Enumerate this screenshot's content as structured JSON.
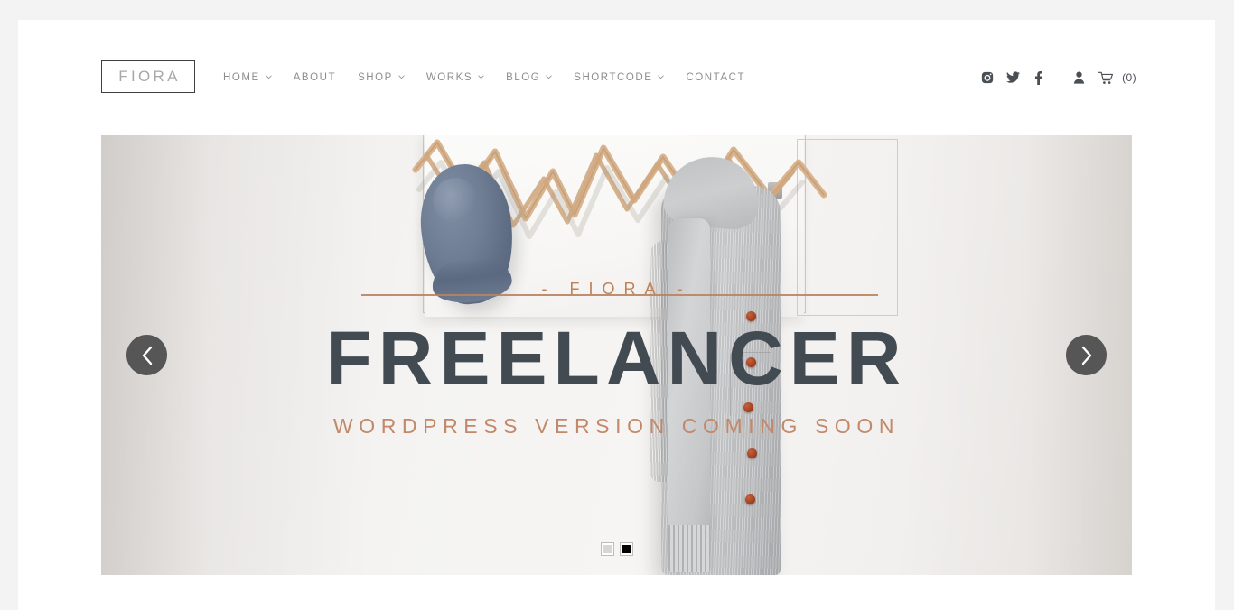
{
  "site": {
    "background_color": "#f3f3f3",
    "container_color": "#ffffff"
  },
  "header": {
    "logo": {
      "text": "FIORA",
      "border_color": "#3f3f3f",
      "text_color": "#a9a7aa"
    },
    "nav_items": [
      {
        "label": "HOME",
        "has_dropdown": true
      },
      {
        "label": "ABOUT",
        "has_dropdown": false
      },
      {
        "label": "SHOP",
        "has_dropdown": true
      },
      {
        "label": "WORKS",
        "has_dropdown": true
      },
      {
        "label": "BLOG",
        "has_dropdown": true
      },
      {
        "label": "SHORTCODE",
        "has_dropdown": true
      },
      {
        "label": "CONTACT",
        "has_dropdown": false
      }
    ],
    "nav_text_color": "#8d8d8d",
    "tools": {
      "social": [
        {
          "icon": "instagram-icon"
        },
        {
          "icon": "twitter-icon"
        },
        {
          "icon": "facebook-icon"
        }
      ],
      "account_icon": "user-icon",
      "cart_icon": "shopping-cart-icon",
      "cart_count_label": "(0)",
      "icon_color": "#4a4f55"
    }
  },
  "hero": {
    "photo_wordmark": "- FIORA -",
    "title": "FREELANCER",
    "subtitle": "WORDPRESS VERSION COMING SOON",
    "title_color": "#434b52",
    "subtitle_color": "#c2886a",
    "photo_wordmark_color": "#c08156",
    "prev_label": "Previous slide",
    "next_label": "Next slide",
    "prev_icon": "chevron-left-icon",
    "next_icon": "chevron-right-icon",
    "arrow_bg_color": "#565656",
    "slides": [
      {
        "index": 1,
        "active": false
      },
      {
        "index": 2,
        "active": true
      }
    ],
    "active_dot_color": "#000000",
    "inactive_dot_color": "#d6d6d6"
  }
}
